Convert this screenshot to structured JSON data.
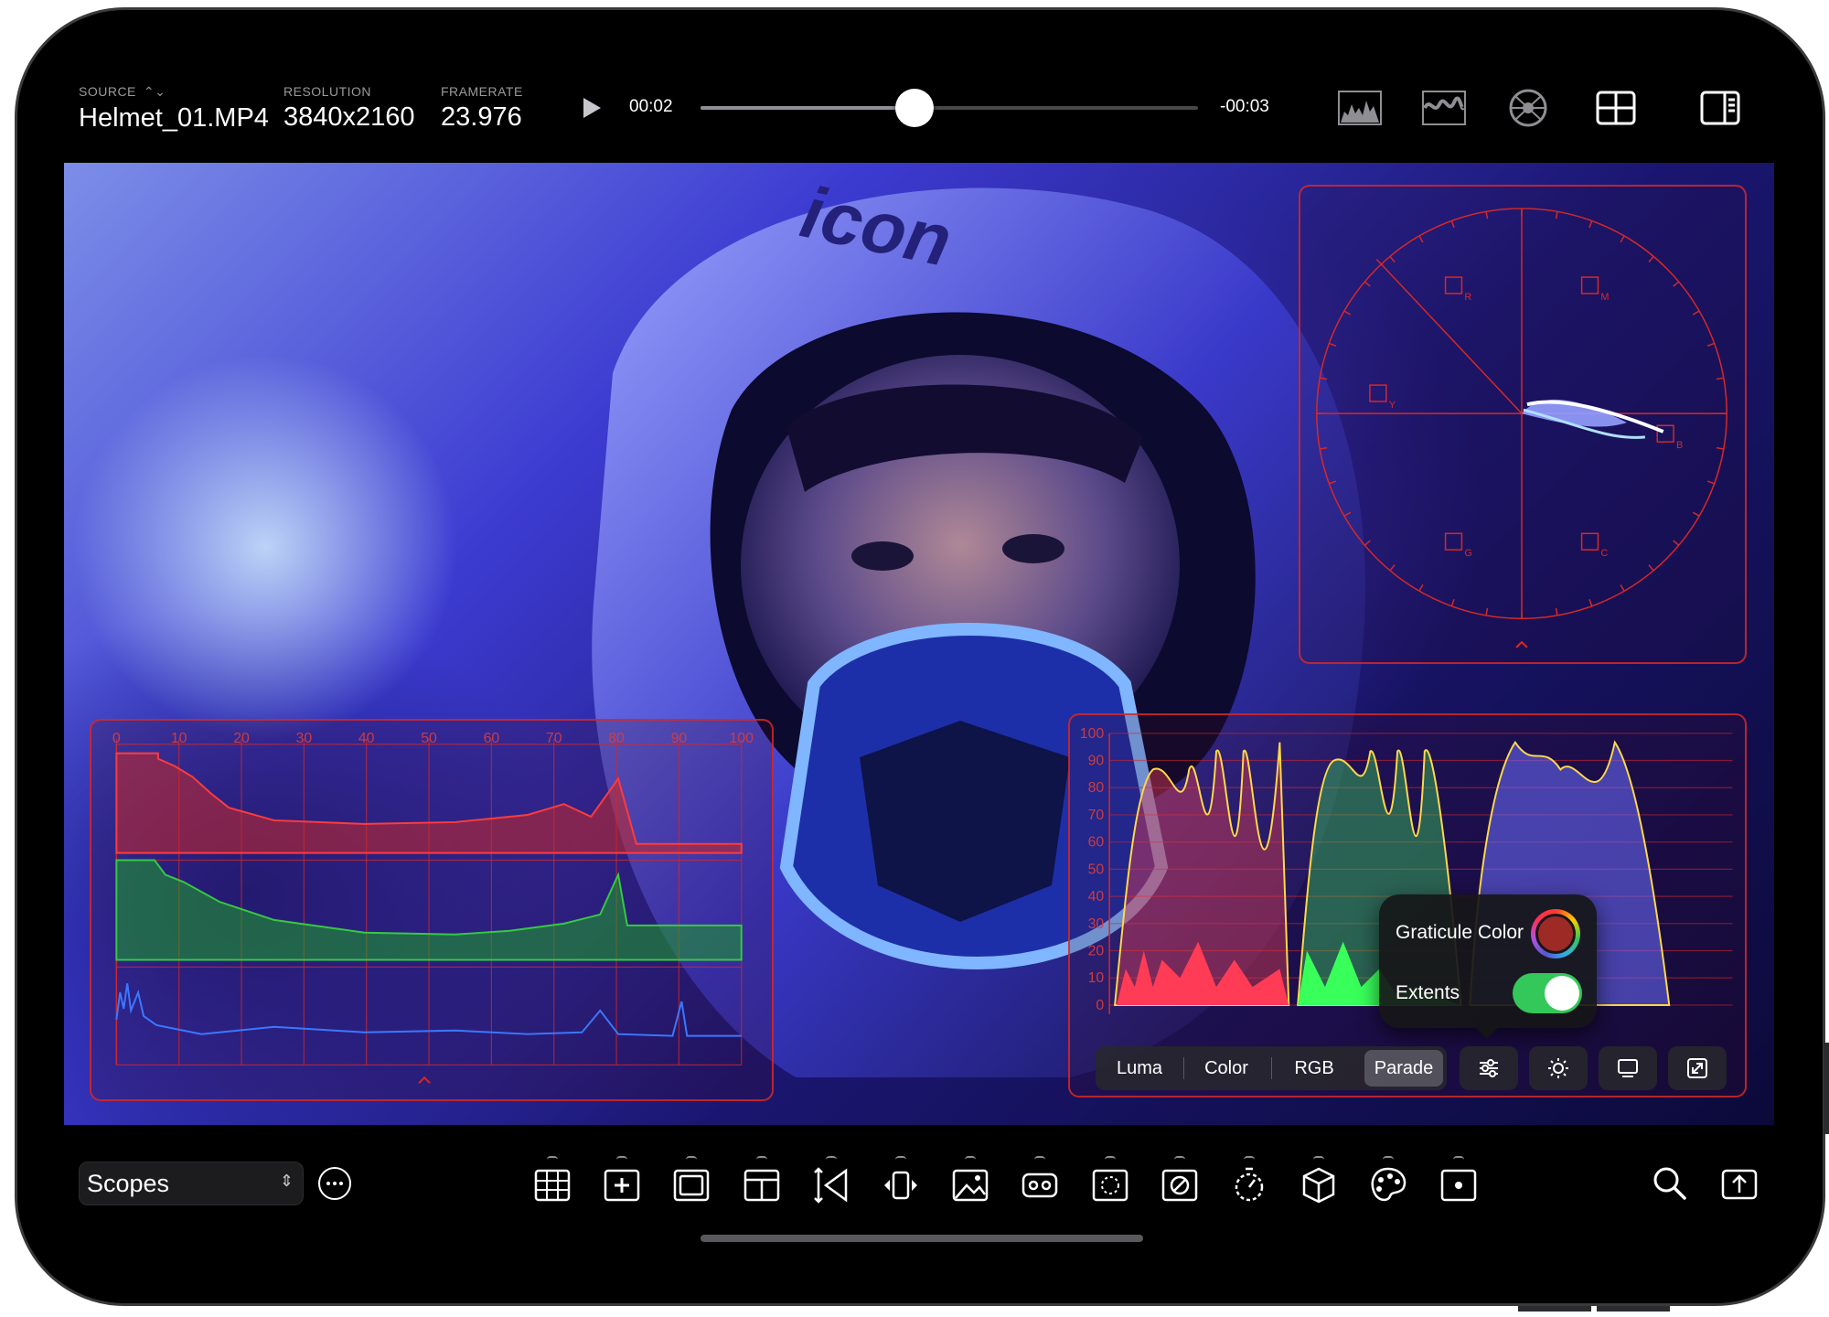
{
  "source": {
    "label": "SOURCE",
    "value": "Helmet_01.MP4"
  },
  "resolution": {
    "label": "RESOLUTION",
    "value": "3840x2160"
  },
  "framerate": {
    "label": "FRAMERATE",
    "value": "23.976"
  },
  "playback": {
    "elapsed": "00:02",
    "remaining": "-00:03",
    "progress": 0.43
  },
  "top_icons": [
    "histogram-icon",
    "waveform-icon",
    "vectorscope-icon",
    "grid-layout-icon",
    "sidebar-icon"
  ],
  "histogram": {
    "scale": [
      "0",
      "10",
      "20",
      "30",
      "40",
      "50",
      "60",
      "70",
      "80",
      "90",
      "100"
    ],
    "channels": [
      "red",
      "green",
      "blue"
    ]
  },
  "waveform": {
    "scale": [
      "100",
      "90",
      "80",
      "70",
      "60",
      "50",
      "40",
      "30",
      "20",
      "10",
      "0"
    ]
  },
  "vectorscope": {
    "targets": [
      "R",
      "M",
      "B",
      "C",
      "G",
      "Y"
    ]
  },
  "popover": {
    "graticule_label": "Graticule Color",
    "graticule_color": "#9e2a26",
    "extents_label": "Extents",
    "extents_on": true
  },
  "scope_modes": {
    "items": [
      "Luma",
      "Color",
      "RGB",
      "Parade"
    ],
    "active": "Parade"
  },
  "scope_buttons": [
    "settings-sliders-icon",
    "brightness-icon",
    "display-icon",
    "expand-icon"
  ],
  "bottom": {
    "workspace": "Scopes",
    "tools": [
      "grid-overlay-icon",
      "add-frame-icon",
      "frame-guide-icon",
      "safe-area-icon",
      "perspective-icon",
      "flip-icon",
      "image-overlay-icon",
      "mask-icon",
      "crop-icon",
      "false-color-icon",
      "timer-icon",
      "lut-cube-icon",
      "palette-icon",
      "focus-icon"
    ]
  },
  "colors": {
    "graticule": "#d72828",
    "accent_green": "#34c759"
  }
}
